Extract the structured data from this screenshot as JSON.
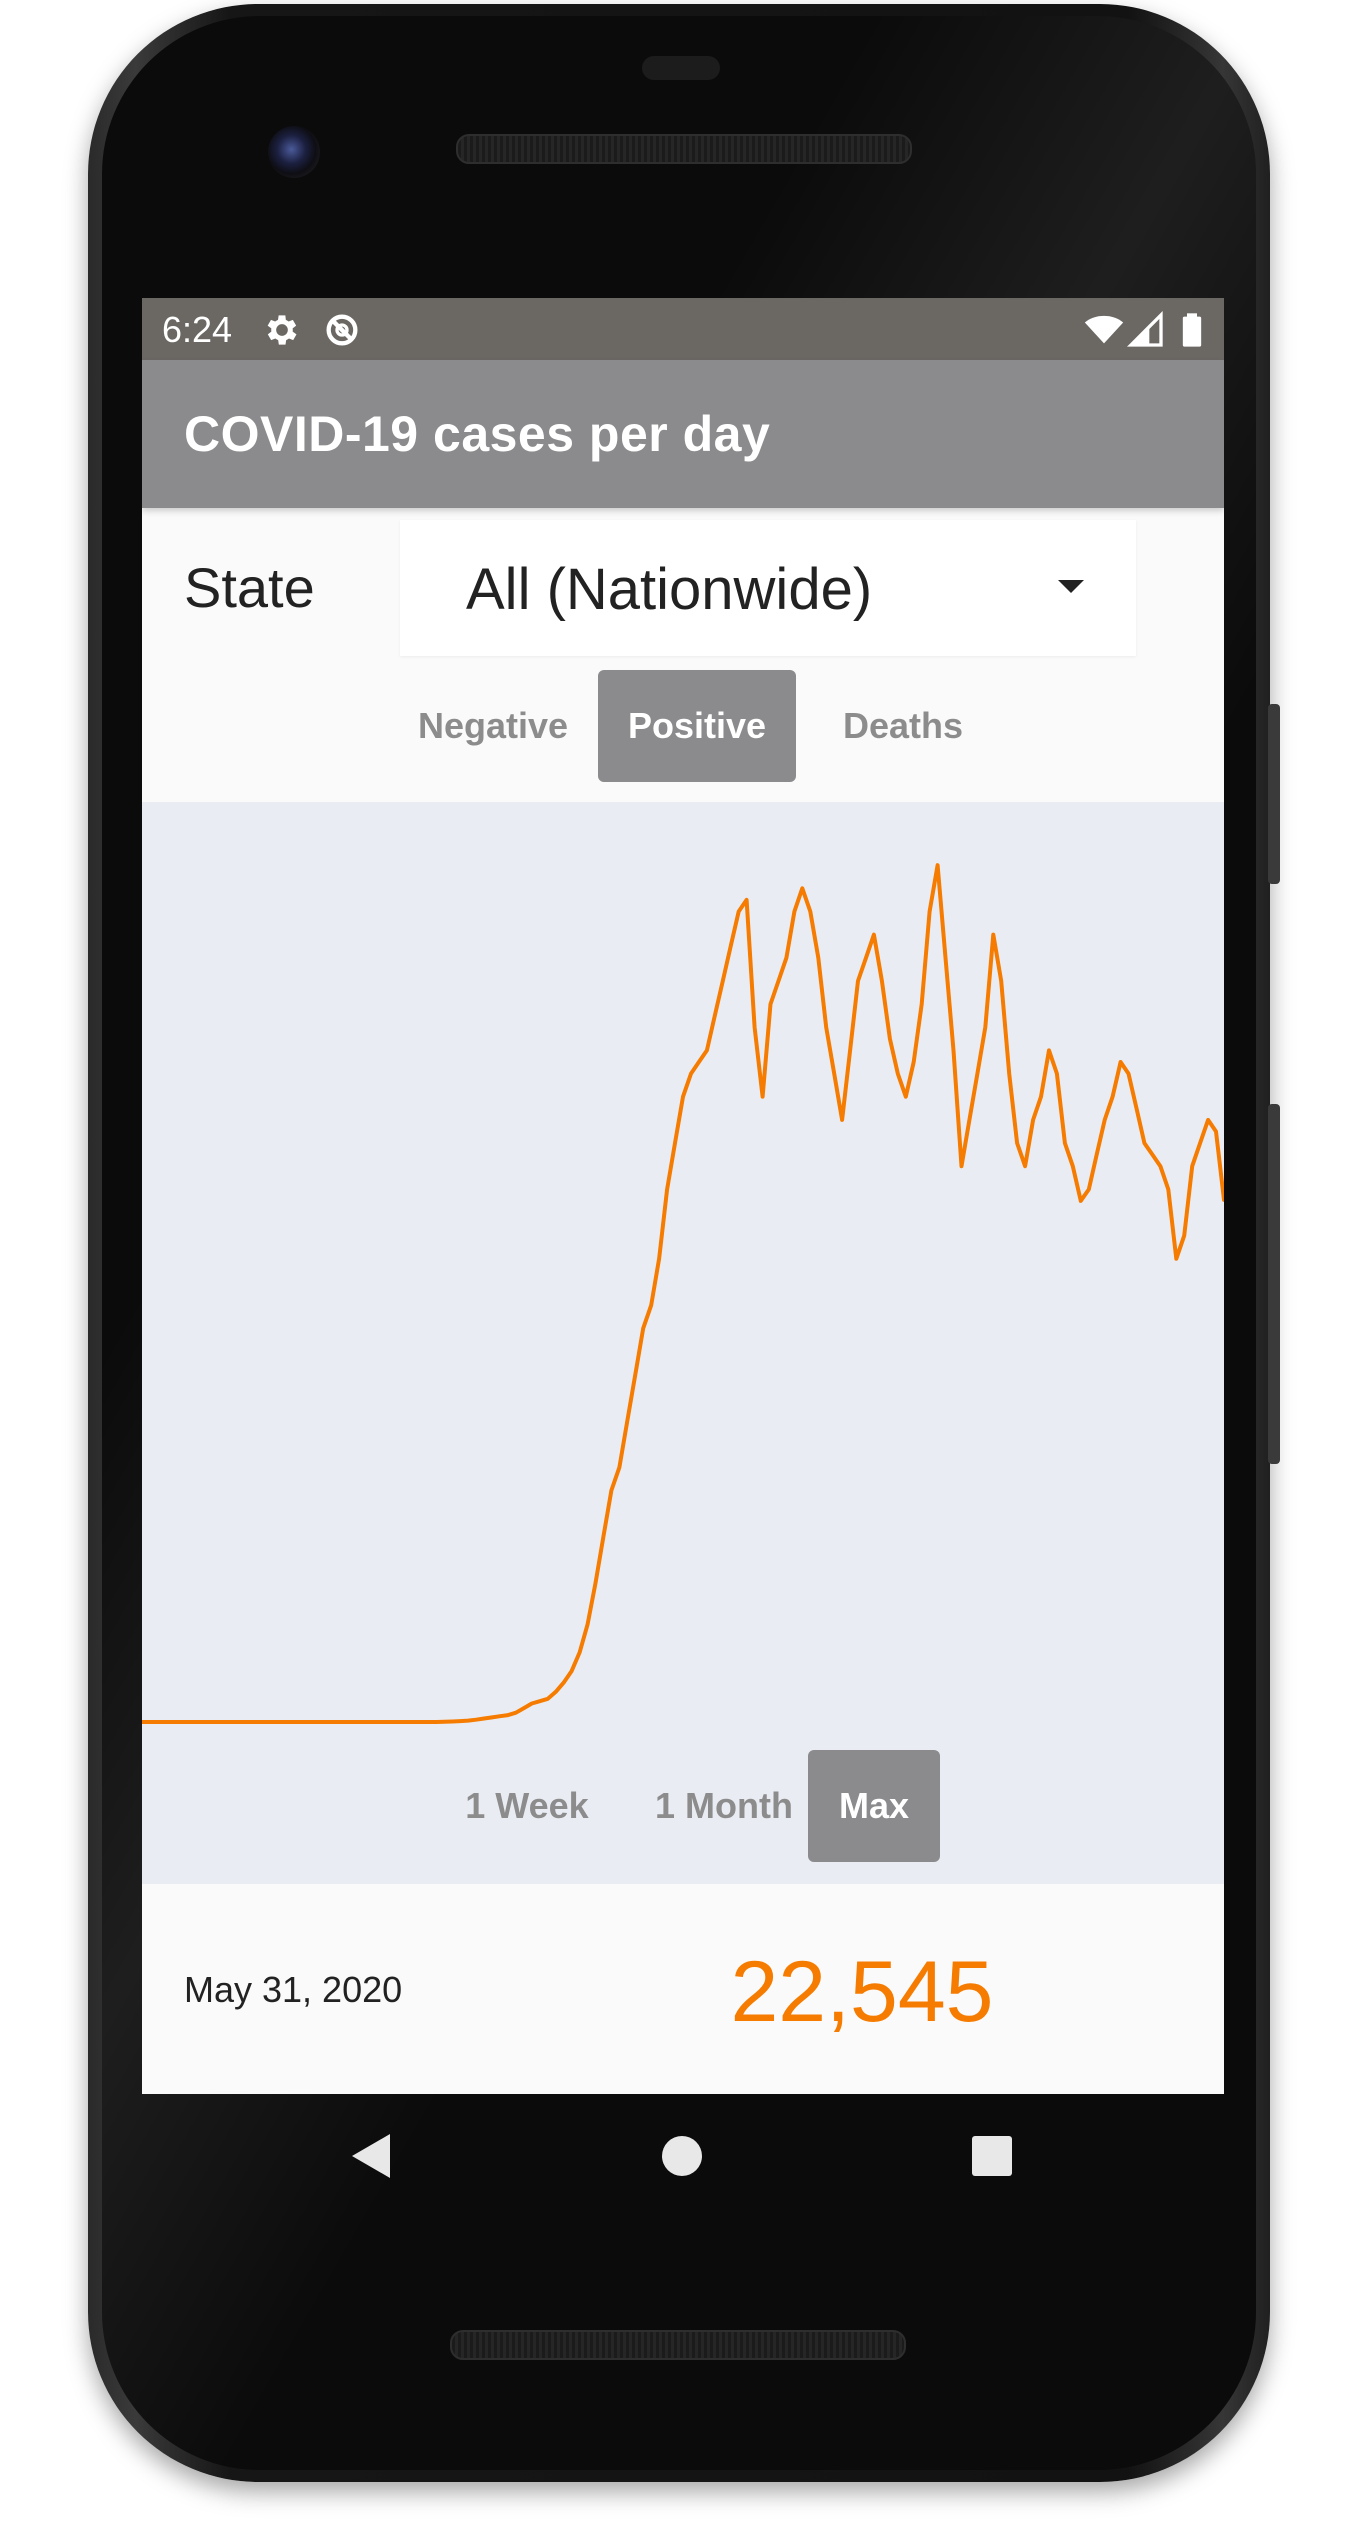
{
  "status_bar": {
    "time": "6:24",
    "icons_left": [
      "gear-icon",
      "no-sync-icon"
    ],
    "icons_right": [
      "wifi-icon",
      "signal-icon",
      "battery-icon"
    ]
  },
  "app_bar": {
    "title": "COVID-19 cases per day"
  },
  "state_filter": {
    "label": "State",
    "selected": "All (Nationwide)"
  },
  "metric_tabs": {
    "items": [
      "Negative",
      "Positive",
      "Deaths"
    ],
    "active": "Positive"
  },
  "range_tabs": {
    "items": [
      "1 Week",
      "1 Month",
      "Max"
    ],
    "active": "Max"
  },
  "selected_point": {
    "date": "May 31, 2020",
    "value": "22,545"
  },
  "colors": {
    "accent": "#f57c00",
    "app_bar": "#8b8b8d",
    "status_bar": "#6b6864",
    "chart_bg": "#eaecf4"
  },
  "chart_data": {
    "type": "line",
    "title": "",
    "xlabel": "",
    "ylabel": "",
    "x_start": "2020-01-22",
    "x_end": "2020-05-31",
    "ylim": [
      0,
      38000
    ],
    "grid": false,
    "series": [
      {
        "values": [
          0,
          0,
          0,
          0,
          0,
          0,
          0,
          0,
          0,
          0,
          0,
          0,
          0,
          0,
          0,
          0,
          0,
          0,
          0,
          0,
          0,
          0,
          0,
          0,
          0,
          0,
          0,
          0,
          0,
          0,
          0,
          0,
          0,
          0,
          0,
          0,
          0,
          0,
          10,
          20,
          40,
          60,
          100,
          150,
          200,
          250,
          300,
          400,
          600,
          800,
          900,
          1000,
          1300,
          1700,
          2200,
          3000,
          4200,
          6000,
          8000,
          10000,
          11000,
          13000,
          15000,
          17000,
          18000,
          20000,
          23000,
          25000,
          27000,
          28000,
          28500,
          29000,
          30500,
          32000,
          33500,
          35000,
          35500,
          30000,
          27000,
          31000,
          32000,
          33000,
          35000,
          36000,
          35000,
          33000,
          30000,
          28000,
          26000,
          29000,
          32000,
          33000,
          34000,
          32000,
          29500,
          28000,
          27000,
          28500,
          31000,
          35000,
          37000,
          33000,
          29000,
          24000,
          26000,
          28000,
          30000,
          34000,
          32000,
          28000,
          25000,
          24000,
          26000,
          27000,
          29000,
          28000,
          25000,
          24000,
          22500,
          23000,
          24500,
          26000,
          27000,
          28500,
          28000,
          26500,
          25000,
          24500,
          24000,
          23000,
          20000,
          21000,
          24000,
          25000,
          26000,
          25500,
          22545
        ]
      }
    ]
  }
}
